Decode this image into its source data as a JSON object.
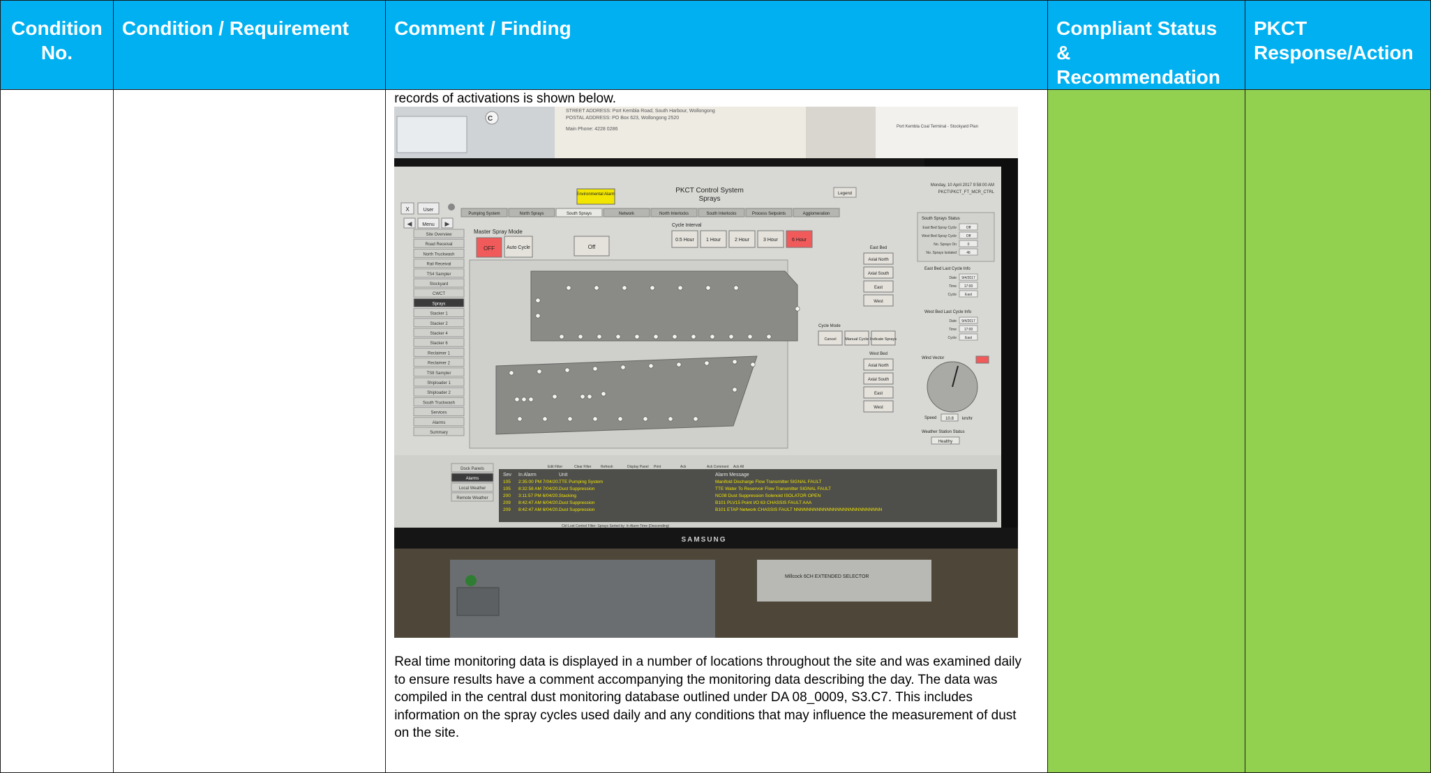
{
  "table": {
    "headers": {
      "condition_no": "Condition No.",
      "condition_requirement": "Condition / Requirement",
      "comment_finding": "Comment / Finding",
      "compliant_status": "Compliant Status & Recommendation",
      "pkct_response": "PKCT Response/Action"
    },
    "row": {
      "lead_text": "records of activations is shown below.",
      "paragraph": "Real time monitoring data is displayed in a number of locations throughout the site and was examined daily to ensure results have a comment accompanying the monitoring data describing the day. The data was compiled in the central dust monitoring database outlined under DA 08_0009, S3.C7. This includes information on the spray cycles used daily and any conditions that may influence the measurement of dust on the site."
    }
  },
  "colors": {
    "header_bg": "#00b0f0",
    "header_text": "#ffffff",
    "status_bg": "#92d050"
  },
  "photo": {
    "paper_lines": [
      "STREET ADDRESS: Port Kembla Road, South Harbour, Wollongong",
      "POSTAL ADDRESS: PO Box 623, Wollongong 2520",
      "Main Phone:  4228 0286"
    ],
    "poster_title": "Port Kembla Coal Terminal - Stockyard Plan",
    "screen": {
      "title": "PKCT Control System",
      "subtitle": "Sprays",
      "env_alarm": "Environmental Alarm",
      "legend": "Legend",
      "datetime": "Monday, 10 April 2017 9:58:00 AM",
      "station": "PKCT\\PKCT_FT_MCR_CTRL",
      "user_btn": "User",
      "close_btn": "X",
      "menu_btn": "Menu",
      "tabs": [
        "Pumping System",
        "North Sprays",
        "South Sprays",
        "Network",
        "North Interlocks",
        "South Interlocks",
        "Process Setpoints",
        "Agglomeration"
      ],
      "nav": [
        "Site Overview",
        "Road Receival",
        "North Truckwash",
        "Rail Receival",
        "TS4 Sampler",
        "Stockyard",
        "CWCT",
        "Sprays",
        "Stacker 1",
        "Stacker 2",
        "Stacker 4",
        "Stacker 6",
        "Reclaimer 1",
        "Reclaimer 2",
        "TS8 Sampler",
        "Shiploader 1",
        "Shiploader 2",
        "South Truckwash",
        "Services",
        "Alarms",
        "Summary"
      ],
      "master_spray_mode": "Master Spray Mode",
      "mode_off": "OFF",
      "mode_auto": "Auto Cycle",
      "mode_status": "Off",
      "cycle_interval": "Cycle Interval",
      "intervals": [
        "0.5 Hour",
        "1 Hour",
        "2 Hour",
        "3 Hour",
        "6 Hour"
      ],
      "east_bed": "East Bed",
      "east_bed_buttons": [
        "Axial North",
        "Axial South",
        "East",
        "West"
      ],
      "cycle_mode": "Cycle Mode",
      "cycle_mode_buttons": [
        "Cancel",
        "Manual Cycle",
        "Indicate Sprays"
      ],
      "west_bed": "West Bed",
      "west_bed_buttons": [
        "Axial North",
        "Axial South",
        "East",
        "West"
      ],
      "south_sprays_status": "South Sprays Status",
      "status_rows": [
        {
          "label": "East Bed Spray Cycle",
          "value": "Off"
        },
        {
          "label": "West Bed Spray Cycle",
          "value": "Off"
        },
        {
          "label": "No. Sprays On",
          "value": "0"
        },
        {
          "label": "No. Sprays Isolated",
          "value": "46"
        }
      ],
      "east_last_cycle": "East Bed Last Cycle Info",
      "east_last_rows": [
        {
          "label": "Date",
          "value": "9/4/2017"
        },
        {
          "label": "Time",
          "value": "17:00"
        },
        {
          "label": "Cycle",
          "value": "East"
        }
      ],
      "west_last_cycle": "West Bed Last Cycle Info",
      "west_last_rows": [
        {
          "label": "Date",
          "value": "9/4/2017"
        },
        {
          "label": "Time",
          "value": "17:00"
        },
        {
          "label": "Cycle",
          "value": "East"
        }
      ],
      "wind_vector": "Wind Vector",
      "wind_speed_label": "Speed",
      "wind_speed_value": "10.8",
      "wind_speed_unit": "km/hr",
      "weather_station_status": "Weather Station Status",
      "weather_status_value": "Healthy",
      "bottom_nav": [
        "Dock Panels",
        "Alarms",
        "Local Weather",
        "Remote Weather"
      ],
      "alarm_toolbar": [
        "Edit Filter",
        "Clear Filter",
        "Refresh",
        "Display Panel",
        "Print",
        "Ack",
        "Ack Comment",
        "Ack All"
      ],
      "alarm_headers": [
        "Sev",
        "In Alarm",
        "Unit",
        "Alarm Message"
      ],
      "alarm_rows": [
        {
          "sev": "105",
          "time": "2:35:00 PM 7/04/20..",
          "unit": "TTE Pumping System",
          "message": "Manifold Discharge Flow Transmitter  SIGNAL FAULT"
        },
        {
          "sev": "105",
          "time": "8:32:58 AM 7/04/20..",
          "unit": "Dust Suppression",
          "message": "TTE Water To Reservoir Flow Transmitter  SIGNAL FAULT"
        },
        {
          "sev": "200",
          "time": "3:11:57 PM 6/04/20..",
          "unit": "Stacking",
          "message": "NC08 Dust Suppression Solenoid ISOLATOR OPEN"
        },
        {
          "sev": "209",
          "time": "8:42:47 AM 6/04/20..",
          "unit": "Dust Suppression",
          "message": "B101 PLV15 Point I/O 63  CHASSIS FAULT AAA"
        },
        {
          "sev": "209",
          "time": "8:42:47 AM 6/04/20..",
          "unit": "Dust Suppression",
          "message": "B101 ETAP Network  CHASSIS FAULT NNNNNNNNNNNNNNNNNNNNNNNNNNN"
        }
      ],
      "alarm_footer": "Ctrl Lost Control   Filter: Sprays   Sorted by: In Alarm Time (Descending)",
      "brand": "SAMSUNG",
      "console_label": "Millcock 6CH EXTENDED SELECTOR"
    }
  }
}
